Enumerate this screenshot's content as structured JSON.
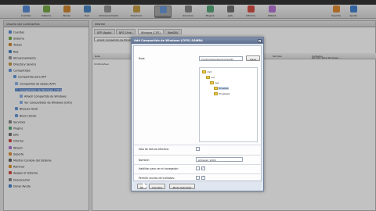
{
  "toolbar": {
    "items": [
      {
        "label": "Cuentas",
        "icon": "users-icon",
        "color": "#4d7fc7"
      },
      {
        "label": "Sistema",
        "icon": "system-icon",
        "color": "#6a9b3c"
      },
      {
        "label": "Tareas",
        "icon": "tasks-icon",
        "color": "#c07a2a"
      },
      {
        "label": "Red",
        "icon": "network-icon",
        "color": "#3f79b5"
      },
      {
        "label": "Almacenamiento",
        "icon": "storage-icon",
        "color": "#8a8a8a"
      },
      {
        "label": "Directorio",
        "icon": "directory-icon",
        "color": "#b78f3b"
      },
      {
        "label": "Compartidos",
        "icon": "shares-icon",
        "color": "#5d8cc9"
      },
      {
        "label": "Servicios",
        "icon": "services-icon",
        "color": "#7a7a7a"
      },
      {
        "label": "Plugins",
        "icon": "plugins-icon",
        "color": "#4c9a6e"
      },
      {
        "label": "Jails",
        "icon": "jails-icon",
        "color": "#666666"
      },
      {
        "label": "Informe",
        "icon": "report-icon",
        "color": "#c6463b"
      },
      {
        "label": "Wizard",
        "icon": "wizard-icon",
        "color": "#a96bc7"
      },
      {
        "label": "Soporte",
        "icon": "support-icon",
        "color": "#d07f2a"
      },
      {
        "label": "Ayuda",
        "icon": "help-icon",
        "color": "#3a78c2"
      }
    ]
  },
  "sidebar": {
    "title": "Usuario raíz   Contraseñas",
    "items": [
      {
        "label": "Cuentas"
      },
      {
        "label": "Sistema"
      },
      {
        "label": "Tareas"
      },
      {
        "label": "Red"
      },
      {
        "label": "Almacenamiento"
      },
      {
        "label": "Directory Service"
      },
      {
        "label": "Compartidos"
      },
      {
        "label": "Compartido para AFP"
      },
      {
        "label": "Compartido de Apple (AFP)"
      },
      {
        "label": "Compartidos de Windows (CIFS)"
      },
      {
        "label": "Añadir Compartido de Windows"
      },
      {
        "label": "Ver Compartidos de Windows (CIFS)"
      },
      {
        "label": "Bloques iSCSI"
      },
      {
        "label": "Block (iSCSI)"
      },
      {
        "label": "Servicios"
      },
      {
        "label": "Plugins"
      },
      {
        "label": "Jails"
      },
      {
        "label": "Informe"
      },
      {
        "label": "Wizard"
      },
      {
        "label": "Soporte"
      },
      {
        "label": "Mostrar Consola del Sistema"
      },
      {
        "label": "Reiniciar"
      },
      {
        "label": "Apagar el Sistema"
      },
      {
        "label": "Desconectar"
      },
      {
        "label": "Donar Ayuda"
      }
    ]
  },
  "main": {
    "header": "Informe",
    "tabs": [
      "AFP (Apple)",
      "NFS (Unix)",
      "Windows (CIFS)",
      "WebDAV"
    ],
    "add_button": "Añadir Compartido de Windows (CIFS)",
    "grid_headers": [
      "Ruta",
      "Nombre",
      "Comentario",
      "Recursos",
      "Permiso",
      "Invitados"
    ],
    "grid_row": "/mnt/vol/Leo",
    "grid_row_extra": "Permitir Para Windows ..."
  },
  "dialog": {
    "title": "Add Compartido de Windows (CIFS) SAMBA",
    "close": "x",
    "path_label": "Ruta:",
    "path_value": "/mnt/vol/Leo/Leo/Compartir",
    "browse_button": "Llave",
    "folders": [
      "mnt",
      "vol",
      "Leo",
      "Pruebas",
      "Pruebas2"
    ],
    "readonly_label": "Sólo de lectura efectivo:",
    "name_label": "Nombre:",
    "name_value": "Almacén_Vol01",
    "auto_create_label": "Habilitar para ver el navegador:",
    "auto_create_checked": true,
    "guest_label": "Permitir acceso de invitados:",
    "guest_checked": true,
    "footer": {
      "ok": "OK",
      "cancel": "Cancelar",
      "advanced": "Modo Avanzado"
    }
  }
}
